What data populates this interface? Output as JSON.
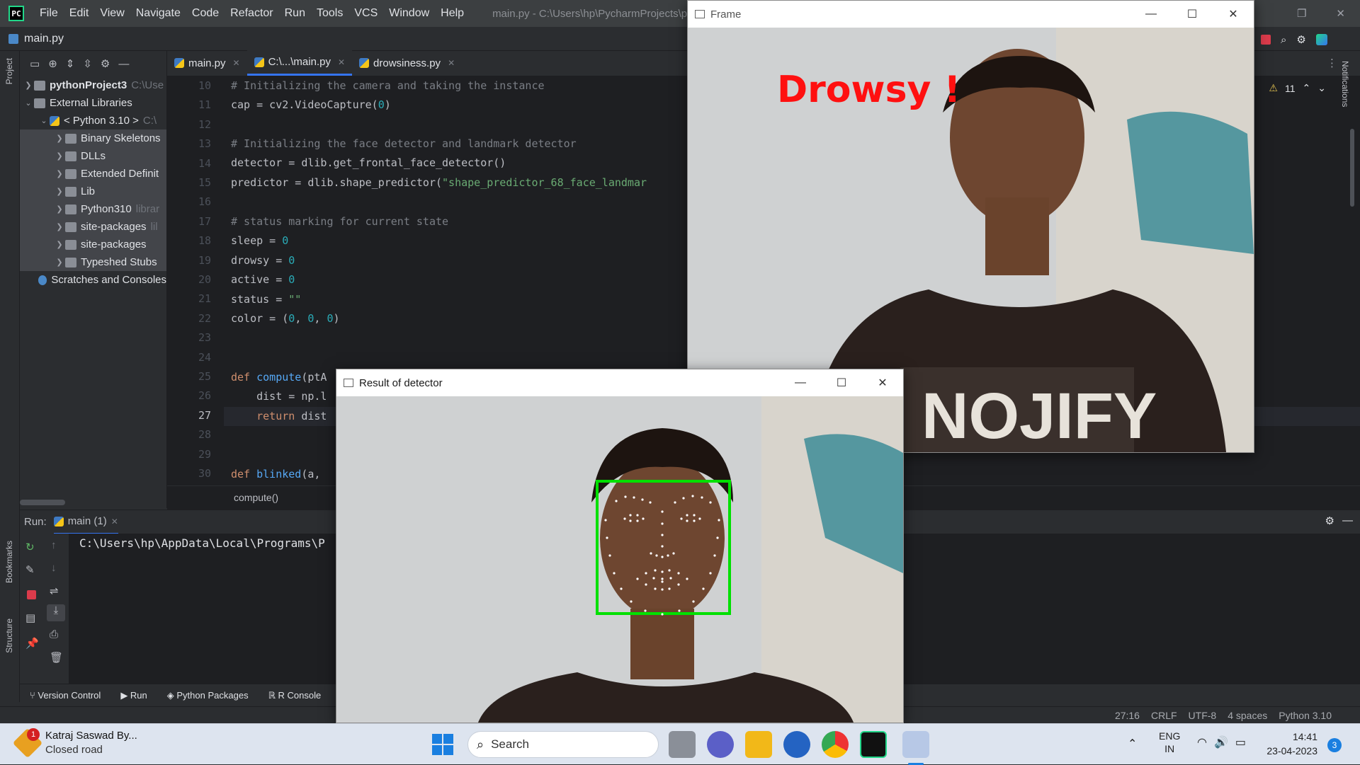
{
  "menu": {
    "items": [
      "File",
      "Edit",
      "View",
      "Navigate",
      "Code",
      "Refactor",
      "Run",
      "Tools",
      "VCS",
      "Window",
      "Help"
    ],
    "window_title": "main.py - C:\\Users\\hp\\PycharmProjects\\python"
  },
  "navbar": {
    "file": "main.py"
  },
  "left_stripe": {
    "project": "Project",
    "bookmarks": "Bookmarks",
    "structure": "Structure"
  },
  "right_stripe": {
    "notifications": "Notifications"
  },
  "project_tree": [
    {
      "label": "pythonProject3",
      "hint": "C:\\Use",
      "bold": true
    },
    {
      "label": "External Libraries",
      "hint": ""
    },
    {
      "label": "< Python 3.10 >",
      "hint": "C:\\"
    },
    {
      "label": "Binary Skeletons",
      "hint": ""
    },
    {
      "label": "DLLs",
      "hint": ""
    },
    {
      "label": "Extended Definit",
      "hint": ""
    },
    {
      "label": "Lib",
      "hint": ""
    },
    {
      "label": "Python310",
      "hint": "librar"
    },
    {
      "label": "site-packages",
      "hint": "lil"
    },
    {
      "label": "site-packages",
      "hint": ""
    },
    {
      "label": "Typeshed Stubs",
      "hint": ""
    },
    {
      "label": "Scratches and Consoles",
      "hint": ""
    }
  ],
  "tabs": [
    "main.py",
    "C:\\...\\main.py",
    "drowsiness.py"
  ],
  "inspections": {
    "warnings": "11"
  },
  "code": {
    "line_numbers": [
      "10",
      "11",
      "12",
      "13",
      "14",
      "15",
      "16",
      "17",
      "18",
      "19",
      "20",
      "21",
      "22",
      "23",
      "24",
      "25",
      "26",
      "27",
      "28",
      "29",
      "30"
    ],
    "l10": "# Initializing the camera and taking the instance",
    "l11a": "cap = cv2.VideoCapture(",
    "l11b": "0",
    "l11c": ")",
    "l13": "# Initializing the face detector and landmark detector",
    "l14": "detector = dlib.get_frontal_face_detector()",
    "l15a": "predictor = dlib.shape_predictor(",
    "l15b": "\"shape_predictor_68_face_landmar",
    "l17": "# status marking for current state",
    "l18a": "sleep = ",
    "l18b": "0",
    "l19a": "drowsy = ",
    "l19b": "0",
    "l20a": "active = ",
    "l20b": "0",
    "l21a": "status = ",
    "l21b": "\"\"",
    "l22a": "color = (",
    "l22b": "0",
    "l22c": ", ",
    "l22d": "0",
    "l22e": ", ",
    "l22f": "0",
    "l22g": ")",
    "l25a": "def ",
    "l25b": "compute",
    "l25c": "(ptA",
    "l26": "    dist = np.l",
    "l27a": "    return",
    "l27b": " dist",
    "l30a": "def ",
    "l30b": "blinked",
    "l30c": "(a,"
  },
  "breadcrumb": "compute()",
  "run": {
    "label": "Run:",
    "tab": "main (1)",
    "output": "C:\\Users\\hp\\AppData\\Local\\Programs\\P"
  },
  "tool_windows": [
    "Version Control",
    "Run",
    "Python Packages",
    "R Console"
  ],
  "status": {
    "position": "27:16",
    "line_sep": "CRLF",
    "encoding": "UTF-8",
    "indent": "4 spaces",
    "interpreter": "Python 3.10"
  },
  "frame_window": {
    "title": "Frame",
    "overlay_text": "Drowsy !",
    "overlay_color": "#ff1010",
    "shirt_text": "NOJIFY"
  },
  "detector_window": {
    "title": "Result of detector",
    "box_color": "#00e000"
  },
  "taskbar": {
    "notification_title": "Katraj Saswad By...",
    "notification_sub": "Closed road",
    "notification_badge": "1",
    "search_placeholder": "Search",
    "lang1": "ENG",
    "lang2": "IN",
    "time": "14:41",
    "date": "23-04-2023",
    "badge": "3"
  },
  "colors": {
    "accent": "#3574f0",
    "ide_bg": "#1e1f22",
    "panel_bg": "#2b2d30"
  }
}
